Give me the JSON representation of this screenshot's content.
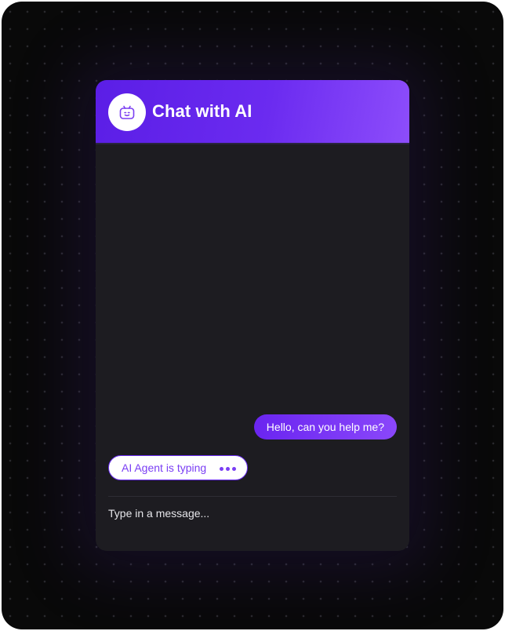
{
  "header": {
    "title": "Chat with AI",
    "avatar_icon": "robot-face-icon"
  },
  "messages": [
    {
      "sender": "user",
      "text": "Hello, can you help me?"
    }
  ],
  "typing_indicator": {
    "label": "AI Agent is typing",
    "icon": "typing-dots-icon"
  },
  "input": {
    "placeholder": "Type in a message...",
    "value": ""
  },
  "colors": {
    "background": "#090909",
    "card": "#1d1c21",
    "accent": "#6b2bf0",
    "accent_light": "#8d4dfb",
    "text": "#ffffff"
  }
}
